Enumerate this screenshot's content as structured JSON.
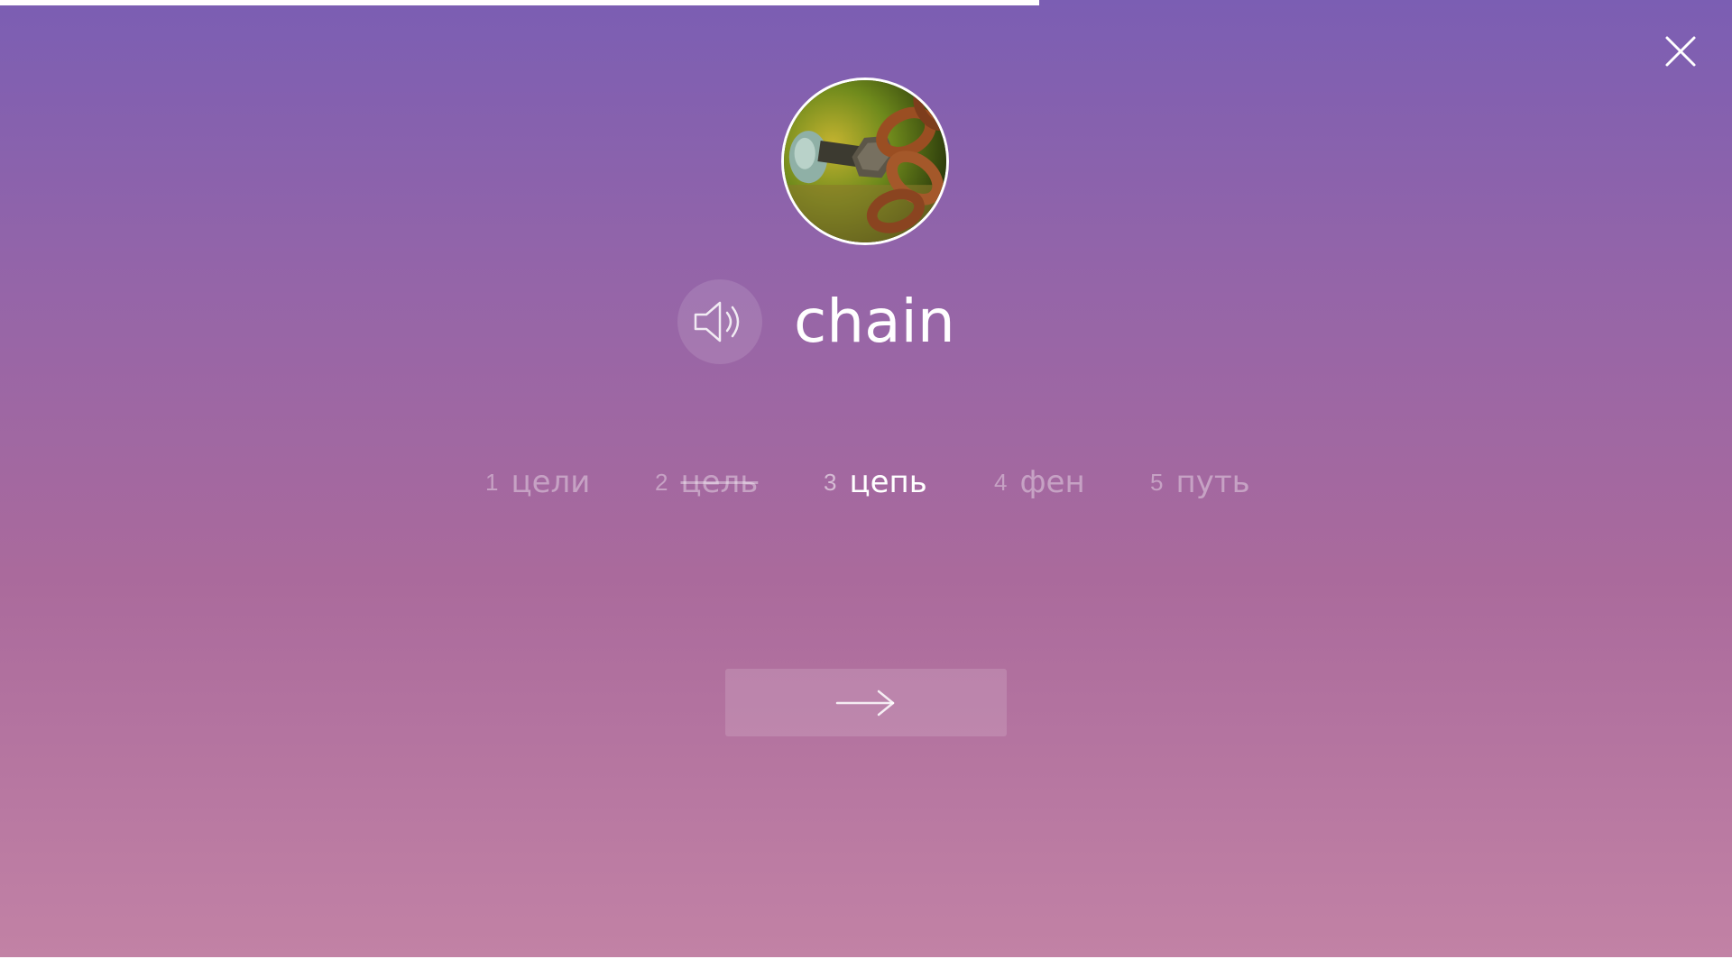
{
  "progress": {
    "fraction": 0.6
  },
  "close": {
    "icon": "close-icon"
  },
  "card": {
    "image_icon": "chain-photo",
    "word": "chain",
    "sound_icon": "speaker-icon"
  },
  "options": [
    {
      "number": "1",
      "label": "цели",
      "state": "default"
    },
    {
      "number": "2",
      "label": "цель",
      "state": "struck"
    },
    {
      "number": "3",
      "label": "цепь",
      "state": "active"
    },
    {
      "number": "4",
      "label": "фен",
      "state": "default"
    },
    {
      "number": "5",
      "label": "путь",
      "state": "default"
    }
  ],
  "next": {
    "icon": "arrow-right-icon"
  },
  "colors": {
    "gradient_top": "#7b5eb3",
    "gradient_bottom": "#c282a5",
    "text": "#ffffff"
  }
}
